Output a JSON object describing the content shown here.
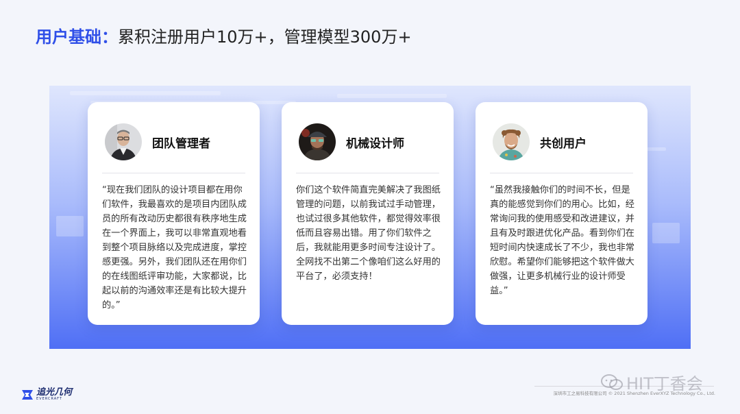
{
  "title": {
    "highlight": "用户基础：",
    "rest": "累积注册用户10万+，管理模型300万+"
  },
  "cards": [
    {
      "role": "团队管理者",
      "avatar_icon": "person-portrait-glasses",
      "quote": "“现在我们团队的设计项目都在用你们软件，我最喜欢的是项目内团队成员的所有改动历史都很有秩序地生成在一个界面上，我可以非常直观地看到整个项目脉络以及完成进度，掌控感更强。另外，我们团队还在用你们的在线图纸评审功能，大家都说，比起以前的沟通效率还是有比较大提升的。”"
    },
    {
      "role": "机械设计师",
      "avatar_icon": "person-portrait-cap",
      "quote": "你们这个软件简直完美解决了我图纸管理的问题，以前我试过手动管理，也试过很多其他软件，都觉得效率很低而且容易出错。用了你们软件之后，我就能用更多时间专注设计了。全网找不出第二个像咱们这么好用的平台了，必须支持！"
    },
    {
      "role": "共创用户",
      "avatar_icon": "person-portrait-curly",
      "quote": "“虽然我接触你们的时间不长，但是真的能感觉到你们的用心。比如，经常询问我的使用感受和改进建议，并且有及时跟进优化产品。看到你们在短时间内快速成长了不少，我也非常欣慰。希望你们能够把这个软件做大做强，让更多机械行业的设计师受益。”"
    }
  ],
  "footer": {
    "logo_name": "追光几何",
    "logo_sub": "EVERCRAFT",
    "copyright": "深圳市工之易科技有限公司 © 2021 Shenzhen EverXYZ Technology Co., Ltd.",
    "watermark": "HIT丁香会"
  },
  "colors": {
    "accent": "#2f4fe8",
    "band_top": "#dfe6fd",
    "band_bottom": "#4f6ff5"
  }
}
